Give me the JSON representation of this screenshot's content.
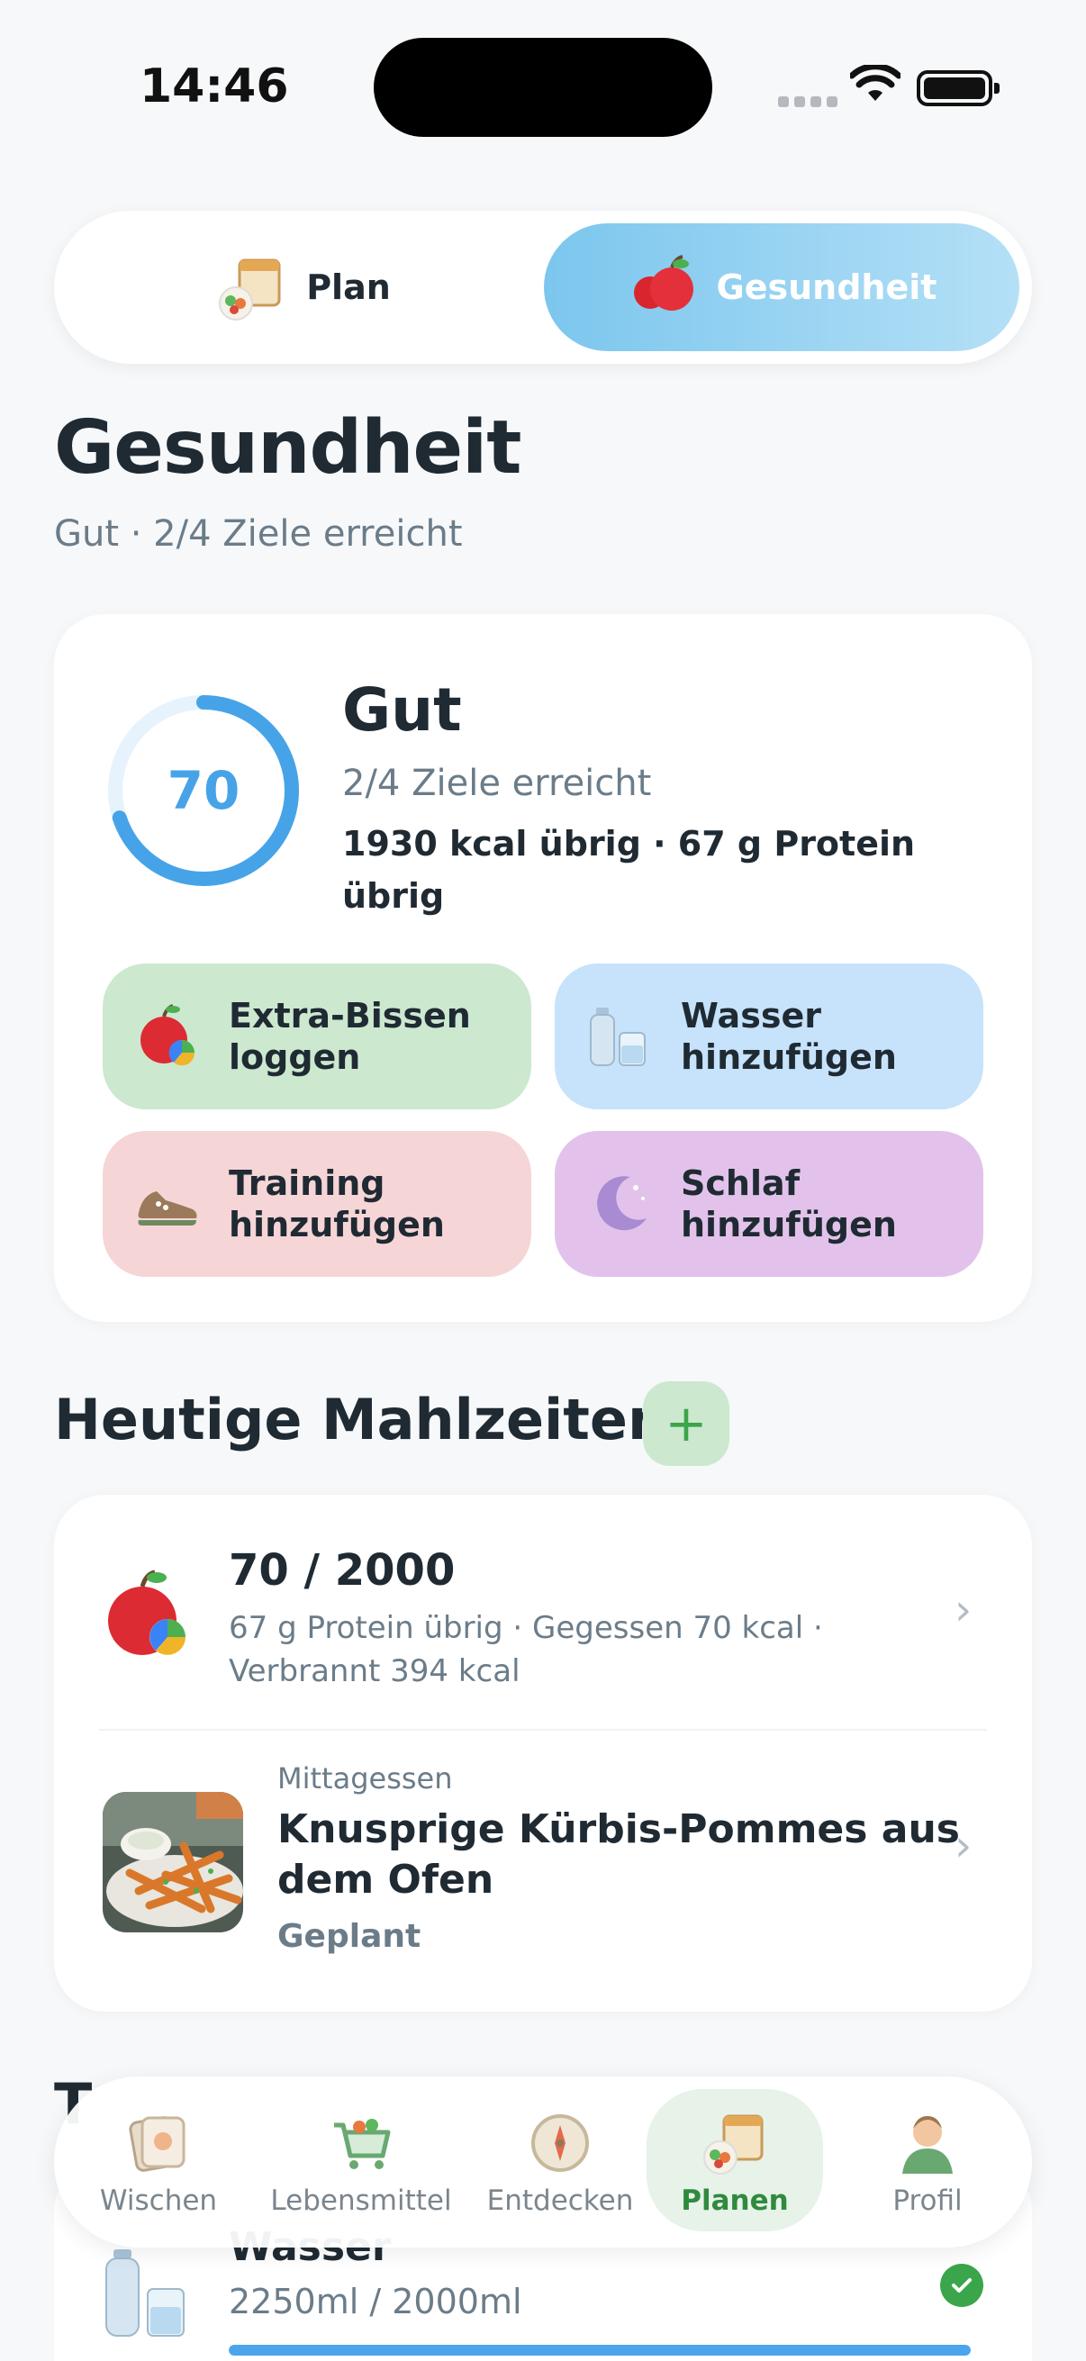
{
  "status_bar": {
    "time": "14:46"
  },
  "toggle": {
    "plan_label": "Plan",
    "health_label": "Gesundheit",
    "active": "Gesundheit"
  },
  "page": {
    "title": "Gesundheit",
    "subtitle": "Gut · 2/4 Ziele erreicht"
  },
  "health_card": {
    "score": "70",
    "score_fraction": 0.7,
    "status": "Gut",
    "goals": "2/4 Ziele erreicht",
    "remaining": "1930 kcal übrig · 67 g Protein übrig",
    "actions": [
      {
        "label": "Extra-Bissen loggen",
        "icon": "apple-chart-icon",
        "color": "#cce8cf"
      },
      {
        "label": "Wasser hinzufügen",
        "icon": "water-bottle-icon",
        "color": "#c6e3fb"
      },
      {
        "label": "Training hinzufügen",
        "icon": "sneaker-icon",
        "color": "#f6d5d7"
      },
      {
        "label": "Schlaf hinzufügen",
        "icon": "moon-icon",
        "color": "#e2c2ea"
      }
    ]
  },
  "meals": {
    "title": "Heutige Mahlzeiten",
    "add_label": "+",
    "summary": {
      "value": "70 / 2000",
      "detail": "67 g Protein übrig · Gegessen 70 kcal · Verbrannt 394 kcal"
    },
    "items": [
      {
        "type": "Mittagessen",
        "name": "Knusprige Kürbis-Pommes aus dem Ofen",
        "status": "Geplant"
      }
    ]
  },
  "tracker": {
    "heading": "T",
    "water": {
      "title": "Wasser",
      "value": "2250ml / 2000ml",
      "progress": 1.0,
      "done": true
    }
  },
  "nav": {
    "items": [
      {
        "label": "Wischen",
        "icon": "swipe-card-icon",
        "active": false
      },
      {
        "label": "Lebensmittel",
        "icon": "shopping-cart-icon",
        "active": false
      },
      {
        "label": "Entdecken",
        "icon": "compass-icon",
        "active": false
      },
      {
        "label": "Planen",
        "icon": "calendar-plate-icon",
        "active": true
      },
      {
        "label": "Profil",
        "icon": "user-avatar-icon",
        "active": false
      }
    ]
  },
  "colors": {
    "accent": "#4ba5ec",
    "active_green": "#2f8a3d",
    "text": "#1f2a33",
    "muted": "#6b7c89"
  }
}
